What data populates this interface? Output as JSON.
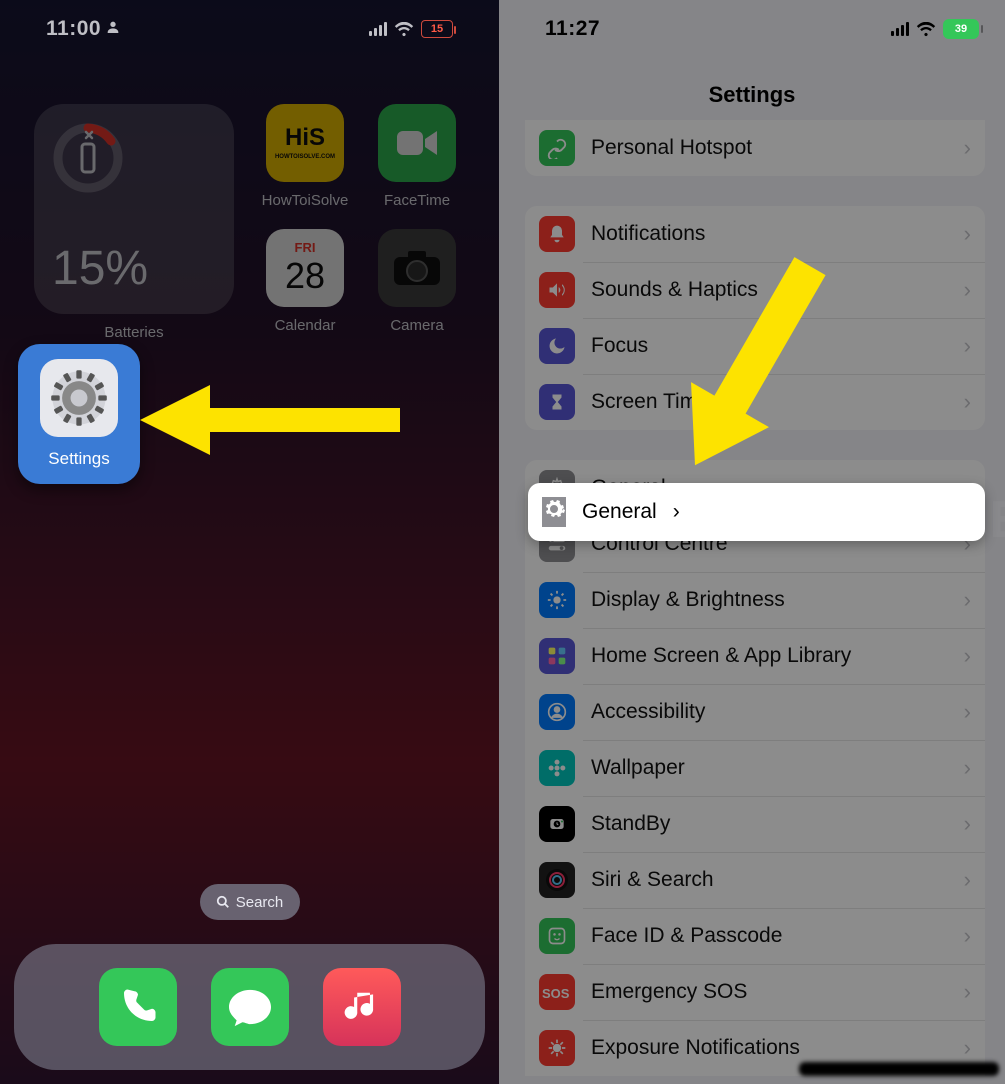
{
  "left": {
    "status": {
      "time": "11:00",
      "battery": "15"
    },
    "battery_widget": {
      "percent": "15%",
      "label": "Batteries"
    },
    "apps": {
      "his": "HowToiSolve",
      "facetime": "FaceTime",
      "calendar": {
        "day": "FRI",
        "date": "28",
        "label": "Calendar"
      },
      "camera": "Camera",
      "settings": "Settings"
    },
    "search": "Search"
  },
  "right": {
    "status": {
      "time": "11:27",
      "battery": "39"
    },
    "title": "Settings",
    "group_top": [
      {
        "id": "personal-hotspot",
        "label": "Personal Hotspot",
        "color": "#34c759",
        "icon": "link"
      }
    ],
    "group_notif": [
      {
        "id": "notifications",
        "label": "Notifications",
        "color": "#ff3b30",
        "icon": "bell"
      },
      {
        "id": "sounds-haptics",
        "label": "Sounds & Haptics",
        "color": "#ff3b30",
        "icon": "speaker"
      },
      {
        "id": "focus",
        "label": "Focus",
        "color": "#5856d6",
        "icon": "moon"
      },
      {
        "id": "screen-time",
        "label": "Screen Time",
        "color": "#5856d6",
        "icon": "hourglass"
      }
    ],
    "general": {
      "label": "General",
      "color": "#8e8e93",
      "icon": "gear"
    },
    "group_main": [
      {
        "id": "general",
        "label": "General",
        "color": "#8e8e93",
        "icon": "gear"
      },
      {
        "id": "control-centre",
        "label": "Control Centre",
        "color": "#8e8e93",
        "icon": "toggles"
      },
      {
        "id": "display-brightness",
        "label": "Display & Brightness",
        "color": "#007aff",
        "icon": "sun"
      },
      {
        "id": "home-screen",
        "label": "Home Screen & App Library",
        "color": "#5856d6",
        "icon": "grid"
      },
      {
        "id": "accessibility",
        "label": "Accessibility",
        "color": "#007aff",
        "icon": "person"
      },
      {
        "id": "wallpaper",
        "label": "Wallpaper",
        "color": "#00c7be",
        "icon": "flower"
      },
      {
        "id": "standby",
        "label": "StandBy",
        "color": "#000000",
        "icon": "clock"
      },
      {
        "id": "siri-search",
        "label": "Siri & Search",
        "color": "#222",
        "icon": "siri"
      },
      {
        "id": "face-id",
        "label": "Face ID & Passcode",
        "color": "#34c759",
        "icon": "face"
      },
      {
        "id": "emergency-sos",
        "label": "Emergency SOS",
        "color": "#ff3b30",
        "icon": "sos"
      },
      {
        "id": "exposure",
        "label": "Exposure Notifications",
        "color": "#ff3b30",
        "icon": "virus"
      }
    ]
  }
}
